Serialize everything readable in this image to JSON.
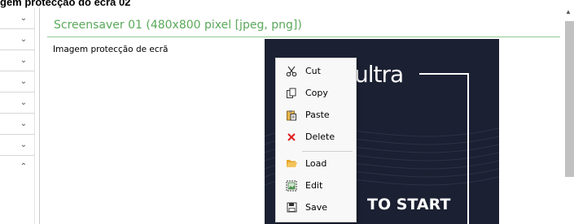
{
  "page": {
    "title_partial": "gem protecção do ecrã 02"
  },
  "left_column": {
    "chevrons": [
      "⌄",
      "⌄",
      "⌄",
      "⌄",
      "⌄",
      "⌄",
      "⌄",
      "⌃"
    ]
  },
  "panel": {
    "header": "Screensaver 01 (480x800 pixel [jpeg, png])",
    "field_label": "Imagem protecção de ecrã"
  },
  "preview": {
    "brand_text": "ultra",
    "start_text": "TO START"
  },
  "context_menu": {
    "items": [
      {
        "label": "Cut",
        "icon": "scissors-icon"
      },
      {
        "label": "Copy",
        "icon": "copy-icon"
      },
      {
        "label": "Paste",
        "icon": "paste-icon"
      },
      {
        "label": "Delete",
        "icon": "delete-x-icon"
      },
      {
        "label": "Load",
        "icon": "folder-open-icon"
      },
      {
        "label": "Edit",
        "icon": "image-edit-icon"
      },
      {
        "label": "Save",
        "icon": "floppy-save-icon"
      }
    ]
  },
  "colors": {
    "header_green": "#5aa85a",
    "preview_bg": "#1b2032",
    "delete_red": "#e02020",
    "folder_orange": "#f3b43a"
  }
}
